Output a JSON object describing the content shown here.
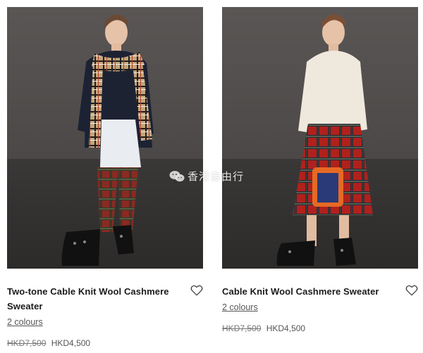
{
  "products": [
    {
      "title": "Two-tone Cable Knit Wool Cashmere Sweater",
      "colours": "2 colours",
      "price_was": "HKD7,500",
      "price_now": "HKD4,500"
    },
    {
      "title": "Cable Knit Wool Cashmere Sweater",
      "colours": "2 colours",
      "price_was": "HKD7,500",
      "price_now": "HKD4,500"
    }
  ],
  "watermark": "香港自由行",
  "colors": {
    "text": "#1a1a1a",
    "muted": "#777777",
    "photo_bg": "#4a4746"
  }
}
